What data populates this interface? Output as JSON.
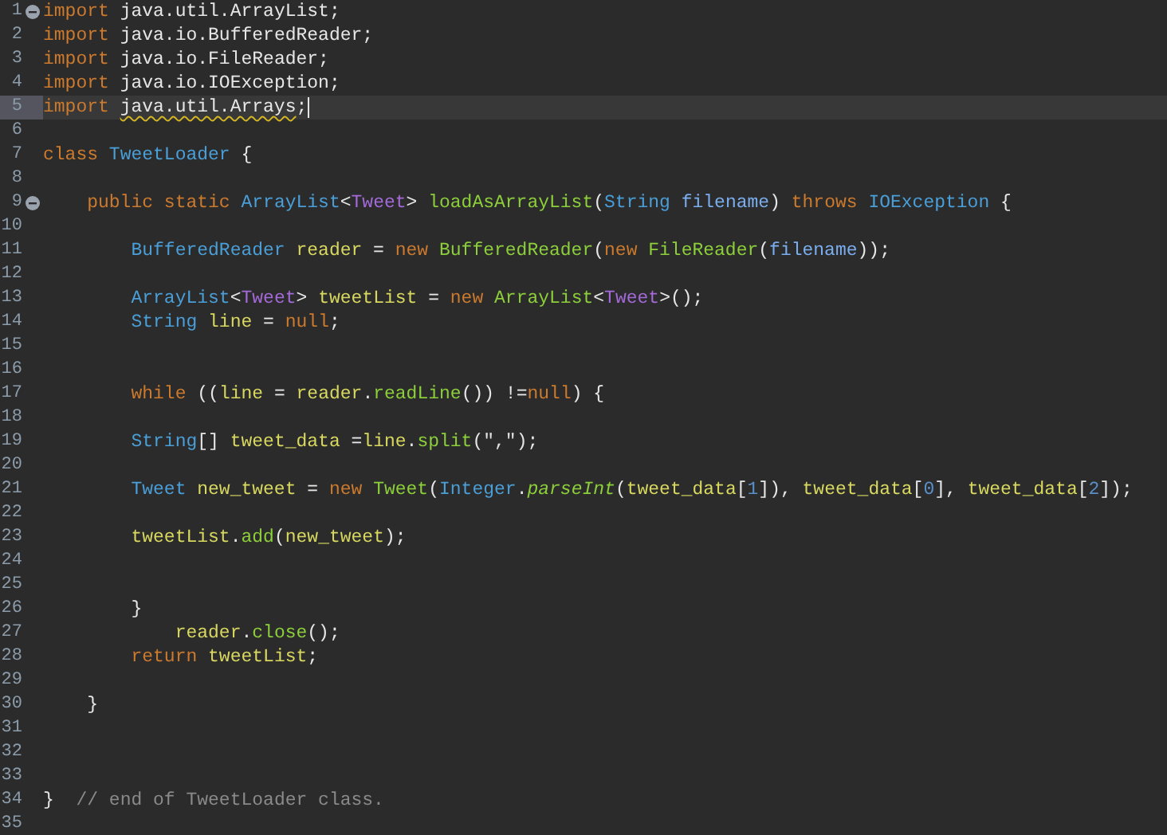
{
  "editor": {
    "lines": [
      {
        "number": "1",
        "current": false,
        "fold": true,
        "tokens": [
          {
            "kind": "kw",
            "text": "import"
          },
          {
            "kind": "plain",
            "text": " java.util.ArrayList;"
          }
        ]
      },
      {
        "number": "2",
        "current": false,
        "fold": false,
        "tokens": [
          {
            "kind": "kw",
            "text": "import"
          },
          {
            "kind": "plain",
            "text": " java.io.BufferedReader;"
          }
        ]
      },
      {
        "number": "3",
        "current": false,
        "fold": false,
        "tokens": [
          {
            "kind": "kw",
            "text": "import"
          },
          {
            "kind": "plain",
            "text": " java.io.FileReader;"
          }
        ]
      },
      {
        "number": "4",
        "current": false,
        "fold": false,
        "tokens": [
          {
            "kind": "kw",
            "text": "import"
          },
          {
            "kind": "plain",
            "text": " java.io.IOException;"
          }
        ]
      },
      {
        "number": "5",
        "current": true,
        "fold": false,
        "tokens": [
          {
            "kind": "kw",
            "text": "import "
          },
          {
            "kind": "warn",
            "text": "java.util.Arrays"
          },
          {
            "kind": "plain",
            "text": ";"
          }
        ]
      },
      {
        "number": "6",
        "current": false,
        "fold": false
      },
      {
        "number": "7",
        "current": false,
        "fold": false,
        "tokens": [
          {
            "kind": "kw",
            "text": "class "
          },
          {
            "kind": "type",
            "text": "TweetLoader"
          },
          {
            "kind": "plain",
            "text": " {"
          }
        ]
      },
      {
        "number": "8",
        "current": false,
        "fold": false
      },
      {
        "number": "9",
        "current": false,
        "fold": true,
        "tokens": [
          {
            "kind": "kw",
            "text": "    public static "
          },
          {
            "kind": "type",
            "text": "ArrayList"
          },
          {
            "kind": "plain",
            "text": "<"
          },
          {
            "kind": "gen",
            "text": "Tweet"
          },
          {
            "kind": "plain",
            "text": "> "
          },
          {
            "kind": "fn",
            "text": "loadAsArrayList"
          },
          {
            "kind": "plain",
            "text": "("
          },
          {
            "kind": "type",
            "text": "String "
          },
          {
            "kind": "param",
            "text": "filename"
          },
          {
            "kind": "plain",
            "text": ") "
          },
          {
            "kind": "kw",
            "text": "throws "
          },
          {
            "kind": "type",
            "text": "IOException"
          },
          {
            "kind": "plain",
            "text": " {"
          }
        ]
      },
      {
        "number": "10",
        "current": false,
        "fold": false
      },
      {
        "number": "11",
        "current": false,
        "fold": false,
        "tokens": [
          {
            "kind": "type",
            "text": "        BufferedReader "
          },
          {
            "kind": "var",
            "text": "reader"
          },
          {
            "kind": "plain",
            "text": " = "
          },
          {
            "kind": "kw",
            "text": "new "
          },
          {
            "kind": "fn",
            "text": "BufferedReader"
          },
          {
            "kind": "plain",
            "text": "("
          },
          {
            "kind": "kw",
            "text": "new "
          },
          {
            "kind": "fn",
            "text": "FileReader"
          },
          {
            "kind": "plain",
            "text": "("
          },
          {
            "kind": "param",
            "text": "filename"
          },
          {
            "kind": "plain",
            "text": "));"
          }
        ]
      },
      {
        "number": "12",
        "current": false,
        "fold": false
      },
      {
        "number": "13",
        "current": false,
        "fold": false,
        "tokens": [
          {
            "kind": "type",
            "text": "        ArrayList"
          },
          {
            "kind": "plain",
            "text": "<"
          },
          {
            "kind": "gen",
            "text": "Tweet"
          },
          {
            "kind": "plain",
            "text": "> "
          },
          {
            "kind": "var",
            "text": "tweetList"
          },
          {
            "kind": "plain",
            "text": " = "
          },
          {
            "kind": "kw",
            "text": "new "
          },
          {
            "kind": "fn",
            "text": "ArrayList"
          },
          {
            "kind": "plain",
            "text": "<"
          },
          {
            "kind": "gen",
            "text": "Tweet"
          },
          {
            "kind": "plain",
            "text": ">();"
          }
        ]
      },
      {
        "number": "14",
        "current": false,
        "fold": false,
        "tokens": [
          {
            "kind": "type",
            "text": "        String "
          },
          {
            "kind": "var",
            "text": "line"
          },
          {
            "kind": "plain",
            "text": " = "
          },
          {
            "kind": "kw",
            "text": "null"
          },
          {
            "kind": "plain",
            "text": ";"
          }
        ]
      },
      {
        "number": "15",
        "current": false,
        "fold": false
      },
      {
        "number": "16",
        "current": false,
        "fold": false
      },
      {
        "number": "17",
        "current": false,
        "fold": false,
        "tokens": [
          {
            "kind": "kw",
            "text": "        while"
          },
          {
            "kind": "plain",
            "text": " (("
          },
          {
            "kind": "var",
            "text": "line"
          },
          {
            "kind": "plain",
            "text": " = "
          },
          {
            "kind": "var",
            "text": "reader"
          },
          {
            "kind": "plain",
            "text": "."
          },
          {
            "kind": "fn",
            "text": "readLine"
          },
          {
            "kind": "plain",
            "text": "()) !="
          },
          {
            "kind": "kw",
            "text": "null"
          },
          {
            "kind": "plain",
            "text": ") {"
          }
        ]
      },
      {
        "number": "18",
        "current": false,
        "fold": false
      },
      {
        "number": "19",
        "current": false,
        "fold": false,
        "tokens": [
          {
            "kind": "type",
            "text": "        String"
          },
          {
            "kind": "plain",
            "text": "[] "
          },
          {
            "kind": "var",
            "text": "tweet_data"
          },
          {
            "kind": "plain",
            "text": " ="
          },
          {
            "kind": "var",
            "text": "line"
          },
          {
            "kind": "plain",
            "text": "."
          },
          {
            "kind": "fn",
            "text": "split"
          },
          {
            "kind": "plain",
            "text": "("
          },
          {
            "kind": "str",
            "text": "\",\""
          },
          {
            "kind": "plain",
            "text": ");"
          }
        ]
      },
      {
        "number": "20",
        "current": false,
        "fold": false
      },
      {
        "number": "21",
        "current": false,
        "fold": false,
        "tokens": [
          {
            "kind": "type",
            "text": "        Tweet "
          },
          {
            "kind": "var",
            "text": "new_tweet"
          },
          {
            "kind": "plain",
            "text": " = "
          },
          {
            "kind": "kw",
            "text": "new "
          },
          {
            "kind": "fn",
            "text": "Tweet"
          },
          {
            "kind": "plain",
            "text": "("
          },
          {
            "kind": "type",
            "text": "Integer"
          },
          {
            "kind": "plain",
            "text": "."
          },
          {
            "kind": "fni",
            "text": "parseInt"
          },
          {
            "kind": "plain",
            "text": "("
          },
          {
            "kind": "var",
            "text": "tweet_data"
          },
          {
            "kind": "plain",
            "text": "["
          },
          {
            "kind": "num",
            "text": "1"
          },
          {
            "kind": "plain",
            "text": "]), "
          },
          {
            "kind": "var",
            "text": "tweet_data"
          },
          {
            "kind": "plain",
            "text": "["
          },
          {
            "kind": "num",
            "text": "0"
          },
          {
            "kind": "plain",
            "text": "], "
          },
          {
            "kind": "var",
            "text": "tweet_data"
          },
          {
            "kind": "plain",
            "text": "["
          },
          {
            "kind": "num",
            "text": "2"
          },
          {
            "kind": "plain",
            "text": "]);"
          }
        ]
      },
      {
        "number": "22",
        "current": false,
        "fold": false
      },
      {
        "number": "23",
        "current": false,
        "fold": false,
        "tokens": [
          {
            "kind": "var",
            "text": "        tweetList"
          },
          {
            "kind": "plain",
            "text": "."
          },
          {
            "kind": "fn",
            "text": "add"
          },
          {
            "kind": "plain",
            "text": "("
          },
          {
            "kind": "var",
            "text": "new_tweet"
          },
          {
            "kind": "plain",
            "text": ");"
          }
        ]
      },
      {
        "number": "24",
        "current": false,
        "fold": false
      },
      {
        "number": "25",
        "current": false,
        "fold": false
      },
      {
        "number": "26",
        "current": false,
        "fold": false,
        "tokens": [
          {
            "kind": "plain",
            "text": "        }"
          }
        ]
      },
      {
        "number": "27",
        "current": false,
        "fold": false,
        "tokens": [
          {
            "kind": "var",
            "text": "            reader"
          },
          {
            "kind": "plain",
            "text": "."
          },
          {
            "kind": "fn",
            "text": "close"
          },
          {
            "kind": "plain",
            "text": "();"
          }
        ]
      },
      {
        "number": "28",
        "current": false,
        "fold": false,
        "tokens": [
          {
            "kind": "kw",
            "text": "        return "
          },
          {
            "kind": "var",
            "text": "tweetList"
          },
          {
            "kind": "plain",
            "text": ";"
          }
        ]
      },
      {
        "number": "29",
        "current": false,
        "fold": false
      },
      {
        "number": "30",
        "current": false,
        "fold": false,
        "tokens": [
          {
            "kind": "plain",
            "text": "    }"
          }
        ]
      },
      {
        "number": "31",
        "current": false,
        "fold": false
      },
      {
        "number": "32",
        "current": false,
        "fold": false
      },
      {
        "number": "33",
        "current": false,
        "fold": false
      },
      {
        "number": "34",
        "current": false,
        "fold": false,
        "tokens": [
          {
            "kind": "plain",
            "text": "}  "
          },
          {
            "kind": "cmt",
            "text": "// end of TweetLoader class."
          }
        ]
      },
      {
        "number": "35",
        "current": false,
        "fold": false
      }
    ]
  }
}
